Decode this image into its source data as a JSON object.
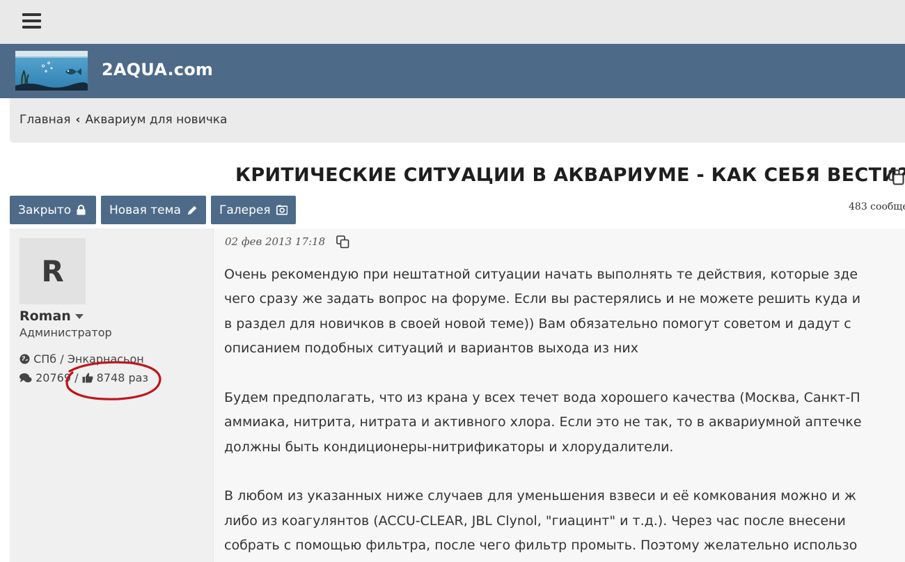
{
  "header": {
    "menu_icon": "hamburger-menu-icon"
  },
  "brand": {
    "logo_icon": "aquarium-fish-logo",
    "name": "2AQUA.com"
  },
  "breadcrumb": {
    "items": [
      "Главная",
      "Аквариум для новичка"
    ],
    "separator": "‹"
  },
  "topic": {
    "title": "КРИТИЧЕСКИЕ СИТУАЦИИ В АКВАРИУМЕ - КАК СЕБЯ ВЕСТИ?",
    "copy_icon": "copy-link-icon",
    "post_count": "483 сообще"
  },
  "buttons": {
    "closed": {
      "label": "Закрыто",
      "icon": "lock-icon"
    },
    "new_topic": {
      "label": "Новая тема",
      "icon": "pencil-icon"
    },
    "gallery": {
      "label": "Галерея",
      "icon": "camera-icon"
    }
  },
  "author": {
    "avatar_letter": "R",
    "name": "Roman",
    "role": "Администратор",
    "location": "СПб / Энкарнасьон",
    "posts": "20769",
    "stats_sep": "/",
    "likes": "8748 раз"
  },
  "post": {
    "date": "02 фев 2013 17:18",
    "paragraphs": [
      [
        "Очень рекомендую при нештатной ситуации начать выполнять те действия, которые зде",
        "чего сразу же задать вопрос на форуме. Если вы растерялись и не можете решить куда и",
        "в раздел для новичков в своей новой теме)) Вам обязательно помогут советом и дадут с",
        "описанием подобных ситуаций и вариантов выхода из них"
      ],
      [
        "Будем предполагать, что из крана у всех течет вода хорошего качества (Москва, Санкт-П",
        "аммиака, нитрита, нитрата и активного хлора. Если это не так, то в аквариумной аптечке",
        "должны быть кондиционеры-нитрификаторы и хлорудалители."
      ],
      [
        "В любом из указанных ниже случаев для уменьшения взвеси и её комкования можно и ж",
        "либо из коагулянтов (ACCU-CLEAR, JBL Clynol, \"гиацинт\" и т.д.). Через час после внесени",
        "собрать с помощью фильтра, после чего фильтр промыть. Поэтому желательно использо"
      ]
    ]
  },
  "colors": {
    "brand_bar": "#4d6b88",
    "button": "#4d6b88",
    "highlight_oval": "#c0141c"
  }
}
